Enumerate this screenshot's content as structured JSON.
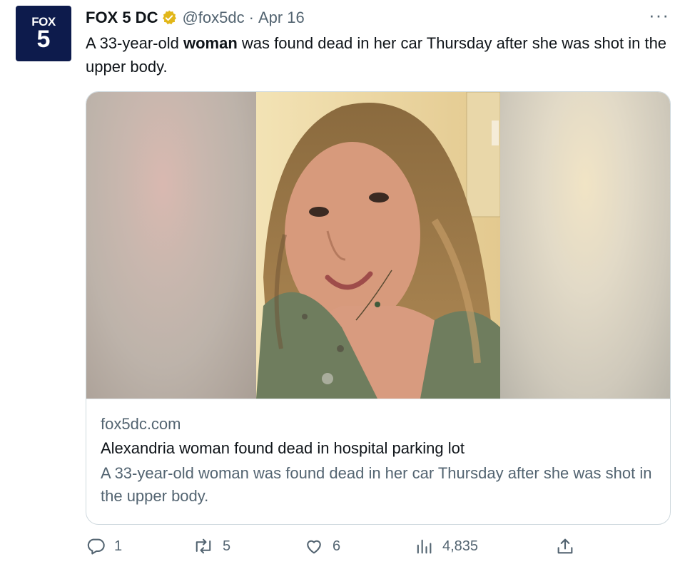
{
  "account": {
    "avatar_brand": "FOX",
    "avatar_number": "5",
    "display_name": "FOX 5 DC",
    "handle": "@fox5dc",
    "separator": "·",
    "date": "Apr 16",
    "verified_icon": "verified-badge-icon",
    "brand_color": "#0d1b4c"
  },
  "more_label": "···",
  "tweet": {
    "text_before": "A 33-year-old ",
    "text_bold": "woman",
    "text_after": " was found dead in her car Thursday after she was shot in the upper body."
  },
  "card": {
    "domain": "fox5dc.com",
    "title": "Alexandria woman found dead in hospital parking lot",
    "description": "A 33-year-old woman was found dead in her car Thursday after she was shot in the upper body."
  },
  "actions": {
    "reply": {
      "icon": "reply-icon",
      "count": "1"
    },
    "retweet": {
      "icon": "retweet-icon",
      "count": "5"
    },
    "like": {
      "icon": "heart-icon",
      "count": "6"
    },
    "views": {
      "icon": "analytics-icon",
      "count": "4,835"
    },
    "share": {
      "icon": "share-icon"
    }
  }
}
